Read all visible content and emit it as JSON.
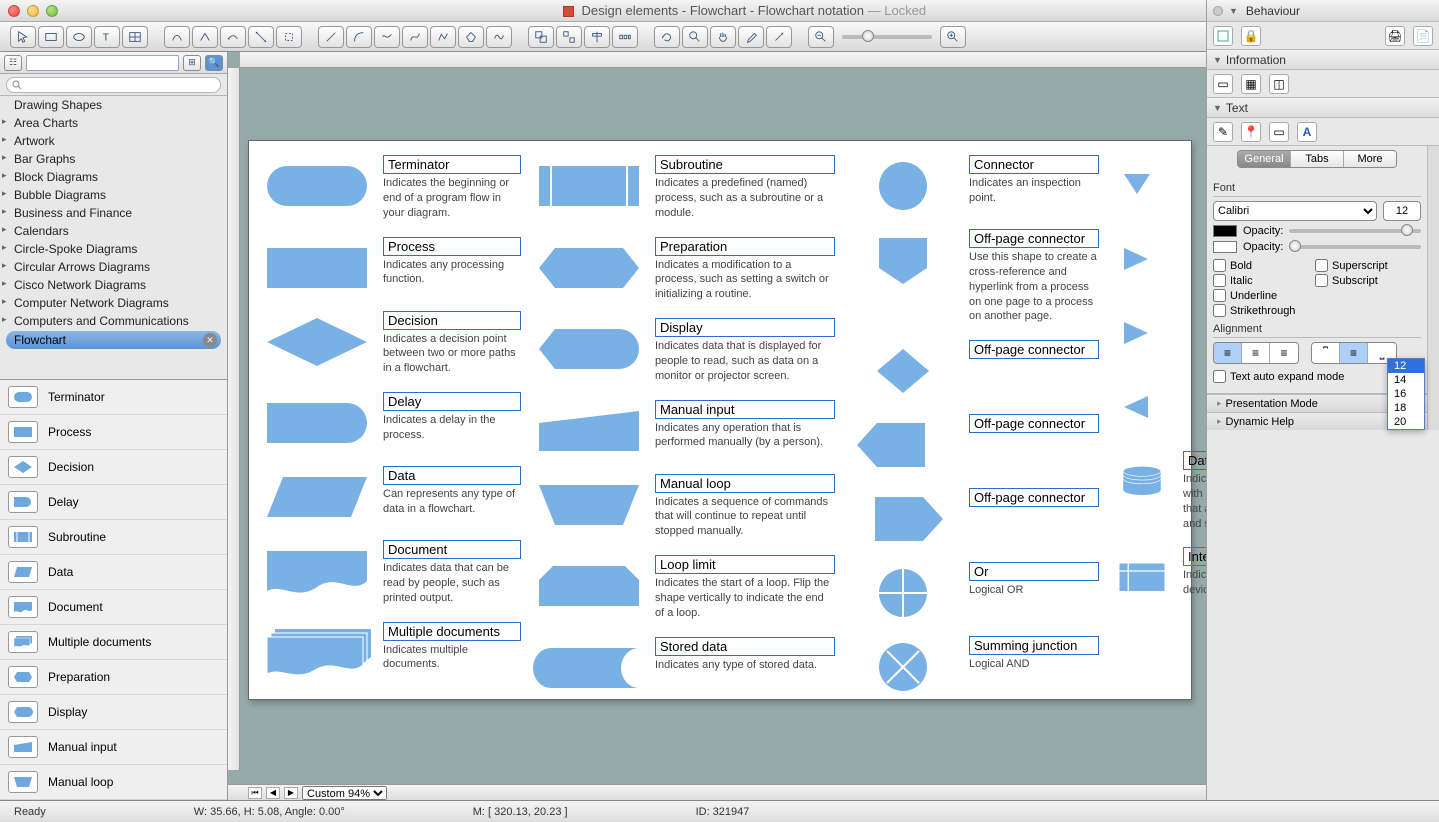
{
  "window": {
    "title_main": "Design elements - Flowchart - Flowchart notation",
    "title_suffix": "— Locked"
  },
  "sidebar": {
    "categories": [
      "Drawing Shapes",
      "Area Charts",
      "Artwork",
      "Bar Graphs",
      "Block Diagrams",
      "Bubble Diagrams",
      "Business and Finance",
      "Calendars",
      "Circle-Spoke Diagrams",
      "Circular Arrows Diagrams",
      "Cisco Network Diagrams",
      "Computer Network Diagrams",
      "Computers and Communications"
    ],
    "selected_category": "Flowchart",
    "shapes": [
      "Terminator",
      "Process",
      "Decision",
      "Delay",
      "Subroutine",
      "Data",
      "Document",
      "Multiple documents",
      "Preparation",
      "Display",
      "Manual input",
      "Manual loop"
    ]
  },
  "canvas": {
    "zoom_label": "Custom 94%",
    "col1": [
      {
        "label": "Terminator",
        "text": "Indicates the beginning or end of a program flow in your diagram."
      },
      {
        "label": "Process",
        "text": "Indicates any processing function."
      },
      {
        "label": "Decision",
        "text": "Indicates a decision point between two or more paths in a flowchart."
      },
      {
        "label": "Delay",
        "text": "Indicates a delay in the process."
      },
      {
        "label": "Data",
        "text": "Can represents any type of data in a flowchart."
      },
      {
        "label": "Document",
        "text": "Indicates data that can be read by people, such as printed output."
      },
      {
        "label": "Multiple documents",
        "text": "Indicates multiple documents."
      }
    ],
    "col2": [
      {
        "label": "Subroutine",
        "text": "Indicates a predefined (named) process, such as a subroutine or a module."
      },
      {
        "label": "Preparation",
        "text": "Indicates a modification to a process, such as setting a switch or initializing a routine."
      },
      {
        "label": "Display",
        "text": "Indicates data that is displayed for people to read, such as data on a monitor or projector screen."
      },
      {
        "label": "Manual input",
        "text": "Indicates any operation that is performed manually (by a person)."
      },
      {
        "label": "Manual loop",
        "text": "Indicates a sequence of commands that will continue to repeat until stopped manually."
      },
      {
        "label": "Loop limit",
        "text": "Indicates the start of a loop. Flip the shape vertically to indicate the end of a loop."
      },
      {
        "label": "Stored data",
        "text": "Indicates any type of stored data."
      }
    ],
    "col3": [
      {
        "label": "Connector",
        "text": "Indicates an inspection point."
      },
      {
        "label": "Off-page connector",
        "text": "Use this shape to create a cross-reference and hyperlink from a process on one page to a process on another page."
      },
      {
        "label": "Off-page connector",
        "text": ""
      },
      {
        "label": "Off-page connector",
        "text": ""
      },
      {
        "label": "Off-page connector",
        "text": ""
      },
      {
        "label": "Or",
        "text": "Logical OR"
      },
      {
        "label": "Summing junction",
        "text": "Logical AND"
      }
    ],
    "col4": [
      {
        "label": "Database",
        "text": "Indicates a list of information with a standard structure that allows for searching and sorting."
      },
      {
        "label": "Internal storage",
        "text": "Indicates an internal storage device.",
        "green": true
      }
    ]
  },
  "right": {
    "sec_behaviour": "Behaviour",
    "sec_information": "Information",
    "sec_text": "Text",
    "tabs": [
      "General",
      "Tabs",
      "More"
    ],
    "active_tab": 0,
    "font_label": "Font",
    "font_family": "Calibri",
    "font_size": "12",
    "font_size_options": [
      "12",
      "14",
      "16",
      "18",
      "20"
    ],
    "opacity_label": "Opacity:",
    "styles": {
      "bold": "Bold",
      "italic": "Italic",
      "underline": "Underline",
      "strike": "Strikethrough",
      "super": "Superscript",
      "sub": "Subscript"
    },
    "alignment_label": "Alignment",
    "auto_expand": "Text auto expand mode",
    "presentation": "Presentation Mode",
    "dynamic_help": "Dynamic Help"
  },
  "status": {
    "ready": "Ready",
    "dims": "W: 35.66,  H: 5.08,  Angle: 0.00°",
    "mouse": "M: [ 320.13, 20.23 ]",
    "id": "ID: 321947"
  }
}
